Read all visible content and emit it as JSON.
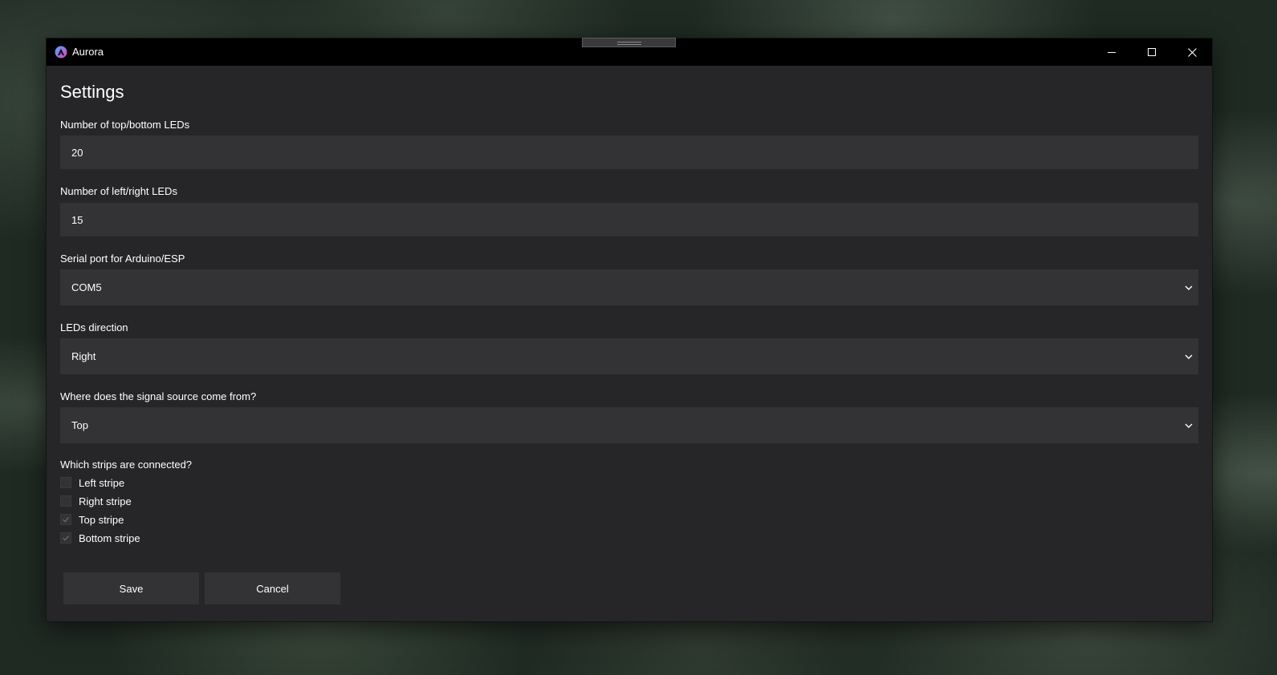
{
  "window": {
    "title": "Aurora"
  },
  "page": {
    "title": "Settings"
  },
  "fields": {
    "top_bottom": {
      "label": "Number of top/bottom LEDs",
      "value": "20"
    },
    "left_right": {
      "label": "Number of left/right LEDs",
      "value": "15"
    },
    "serial_port": {
      "label": "Serial port for Arduino/ESP",
      "value": "COM5"
    },
    "direction": {
      "label": "LEDs direction",
      "value": "Right"
    },
    "signal_source": {
      "label": "Where does the signal source come from?",
      "value": "Top"
    }
  },
  "strips": {
    "label": "Which strips are connected?",
    "items": [
      {
        "label": "Left stripe",
        "checked": false
      },
      {
        "label": "Right stripe",
        "checked": false
      },
      {
        "label": "Top stripe",
        "checked": true
      },
      {
        "label": "Bottom stripe",
        "checked": true
      }
    ]
  },
  "buttons": {
    "save": "Save",
    "cancel": "Cancel"
  },
  "icons": {
    "app": "aurora-app-icon",
    "minimize": "minimize-icon",
    "maximize": "maximize-icon",
    "close": "close-icon",
    "dropdown": "chevron-down-icon",
    "check": "checkmark-icon"
  },
  "colors": {
    "window_bg": "#262628",
    "titlebar_bg": "#000000",
    "control_bg": "#333335",
    "text": "#ffffff",
    "check_mark": "#6a6a6c",
    "icon_gradient_start": "#4aa8ff",
    "icon_gradient_end": "#e040c8"
  }
}
